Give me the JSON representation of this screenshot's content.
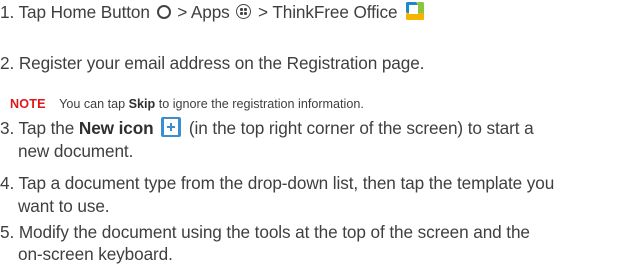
{
  "steps": [
    {
      "num": "1.",
      "pre": "Tap",
      "home": "Home Button",
      "sep1": ">",
      "apps": "Apps",
      "sep2": ">",
      "office": "ThinkFree Office"
    },
    {
      "num": "2.",
      "text": "Register your email address on the Registration page."
    },
    {
      "num": "3.",
      "pre": "Tap the",
      "bold": "New icon",
      "post": "(in the top right corner of the screen) to start a",
      "cont": "new document."
    },
    {
      "num": "4.",
      "text": "Tap a document type from the drop-down list, then tap the template you",
      "cont": "want to use."
    },
    {
      "num": "5.",
      "text": "Modify the document using the tools at the top of the screen and the",
      "cont": "on-screen keyboard."
    }
  ],
  "note": {
    "label": "NOTE",
    "pre": "You can tap",
    "bold": "Skip",
    "post": "to ignore the registration information."
  },
  "icons": {
    "home": "circle-outline-icon",
    "apps": "apps-grid-icon",
    "office": "thinkfree-office-icon",
    "new": "new-document-icon"
  },
  "colors": {
    "text": "#3f3f3f",
    "note_label": "#e0181b",
    "office_blue": "#1e88c8",
    "office_green": "#8cc63e",
    "office_yellow": "#f5b400",
    "new_icon": "#3b8fd0"
  }
}
